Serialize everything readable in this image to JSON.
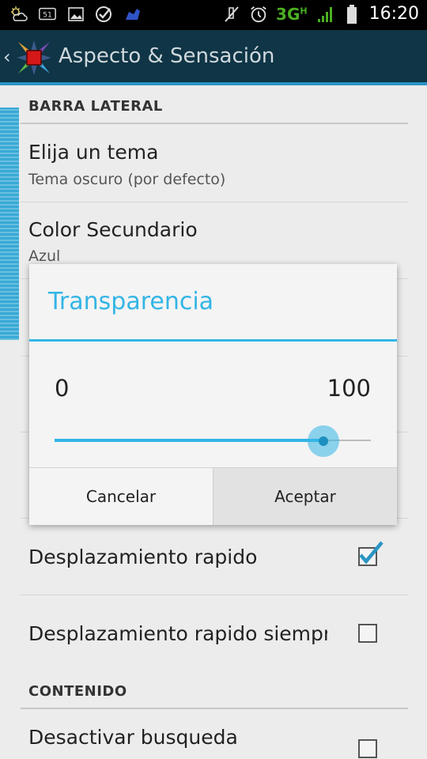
{
  "status_bar": {
    "icons_left": [
      "weather-icon",
      "notification-51-icon",
      "image-icon",
      "check-circle-icon",
      "app-icon"
    ],
    "badge_51": "51",
    "network": "3G",
    "network_sup": "H",
    "time": "16:20"
  },
  "action_bar": {
    "title": "Aspecto & Sensación",
    "accent_color": "#2a95c4"
  },
  "list": {
    "category_sidebar": "BARRA LATERAL",
    "items": [
      {
        "title": "Elija un tema",
        "summary": "Tema oscuro (por defecto)"
      },
      {
        "title": "Color Secundario",
        "summary": "Azul"
      }
    ],
    "check_items": [
      {
        "title": "Desplazamiento rapido",
        "checked": true
      },
      {
        "title": "Desplazamiento rapido siempre",
        "checked": false
      }
    ],
    "category_content": "CONTENIDO",
    "content_items": [
      {
        "title": "Desactivar busqueda",
        "checked": false
      }
    ]
  },
  "dialog": {
    "title": "Transparencia",
    "min_label": "0",
    "max_label": "100",
    "slider_value": 85,
    "slider_max": 100,
    "cancel_label": "Cancelar",
    "ok_label": "Aceptar",
    "accent_color": "#33b5e5"
  }
}
